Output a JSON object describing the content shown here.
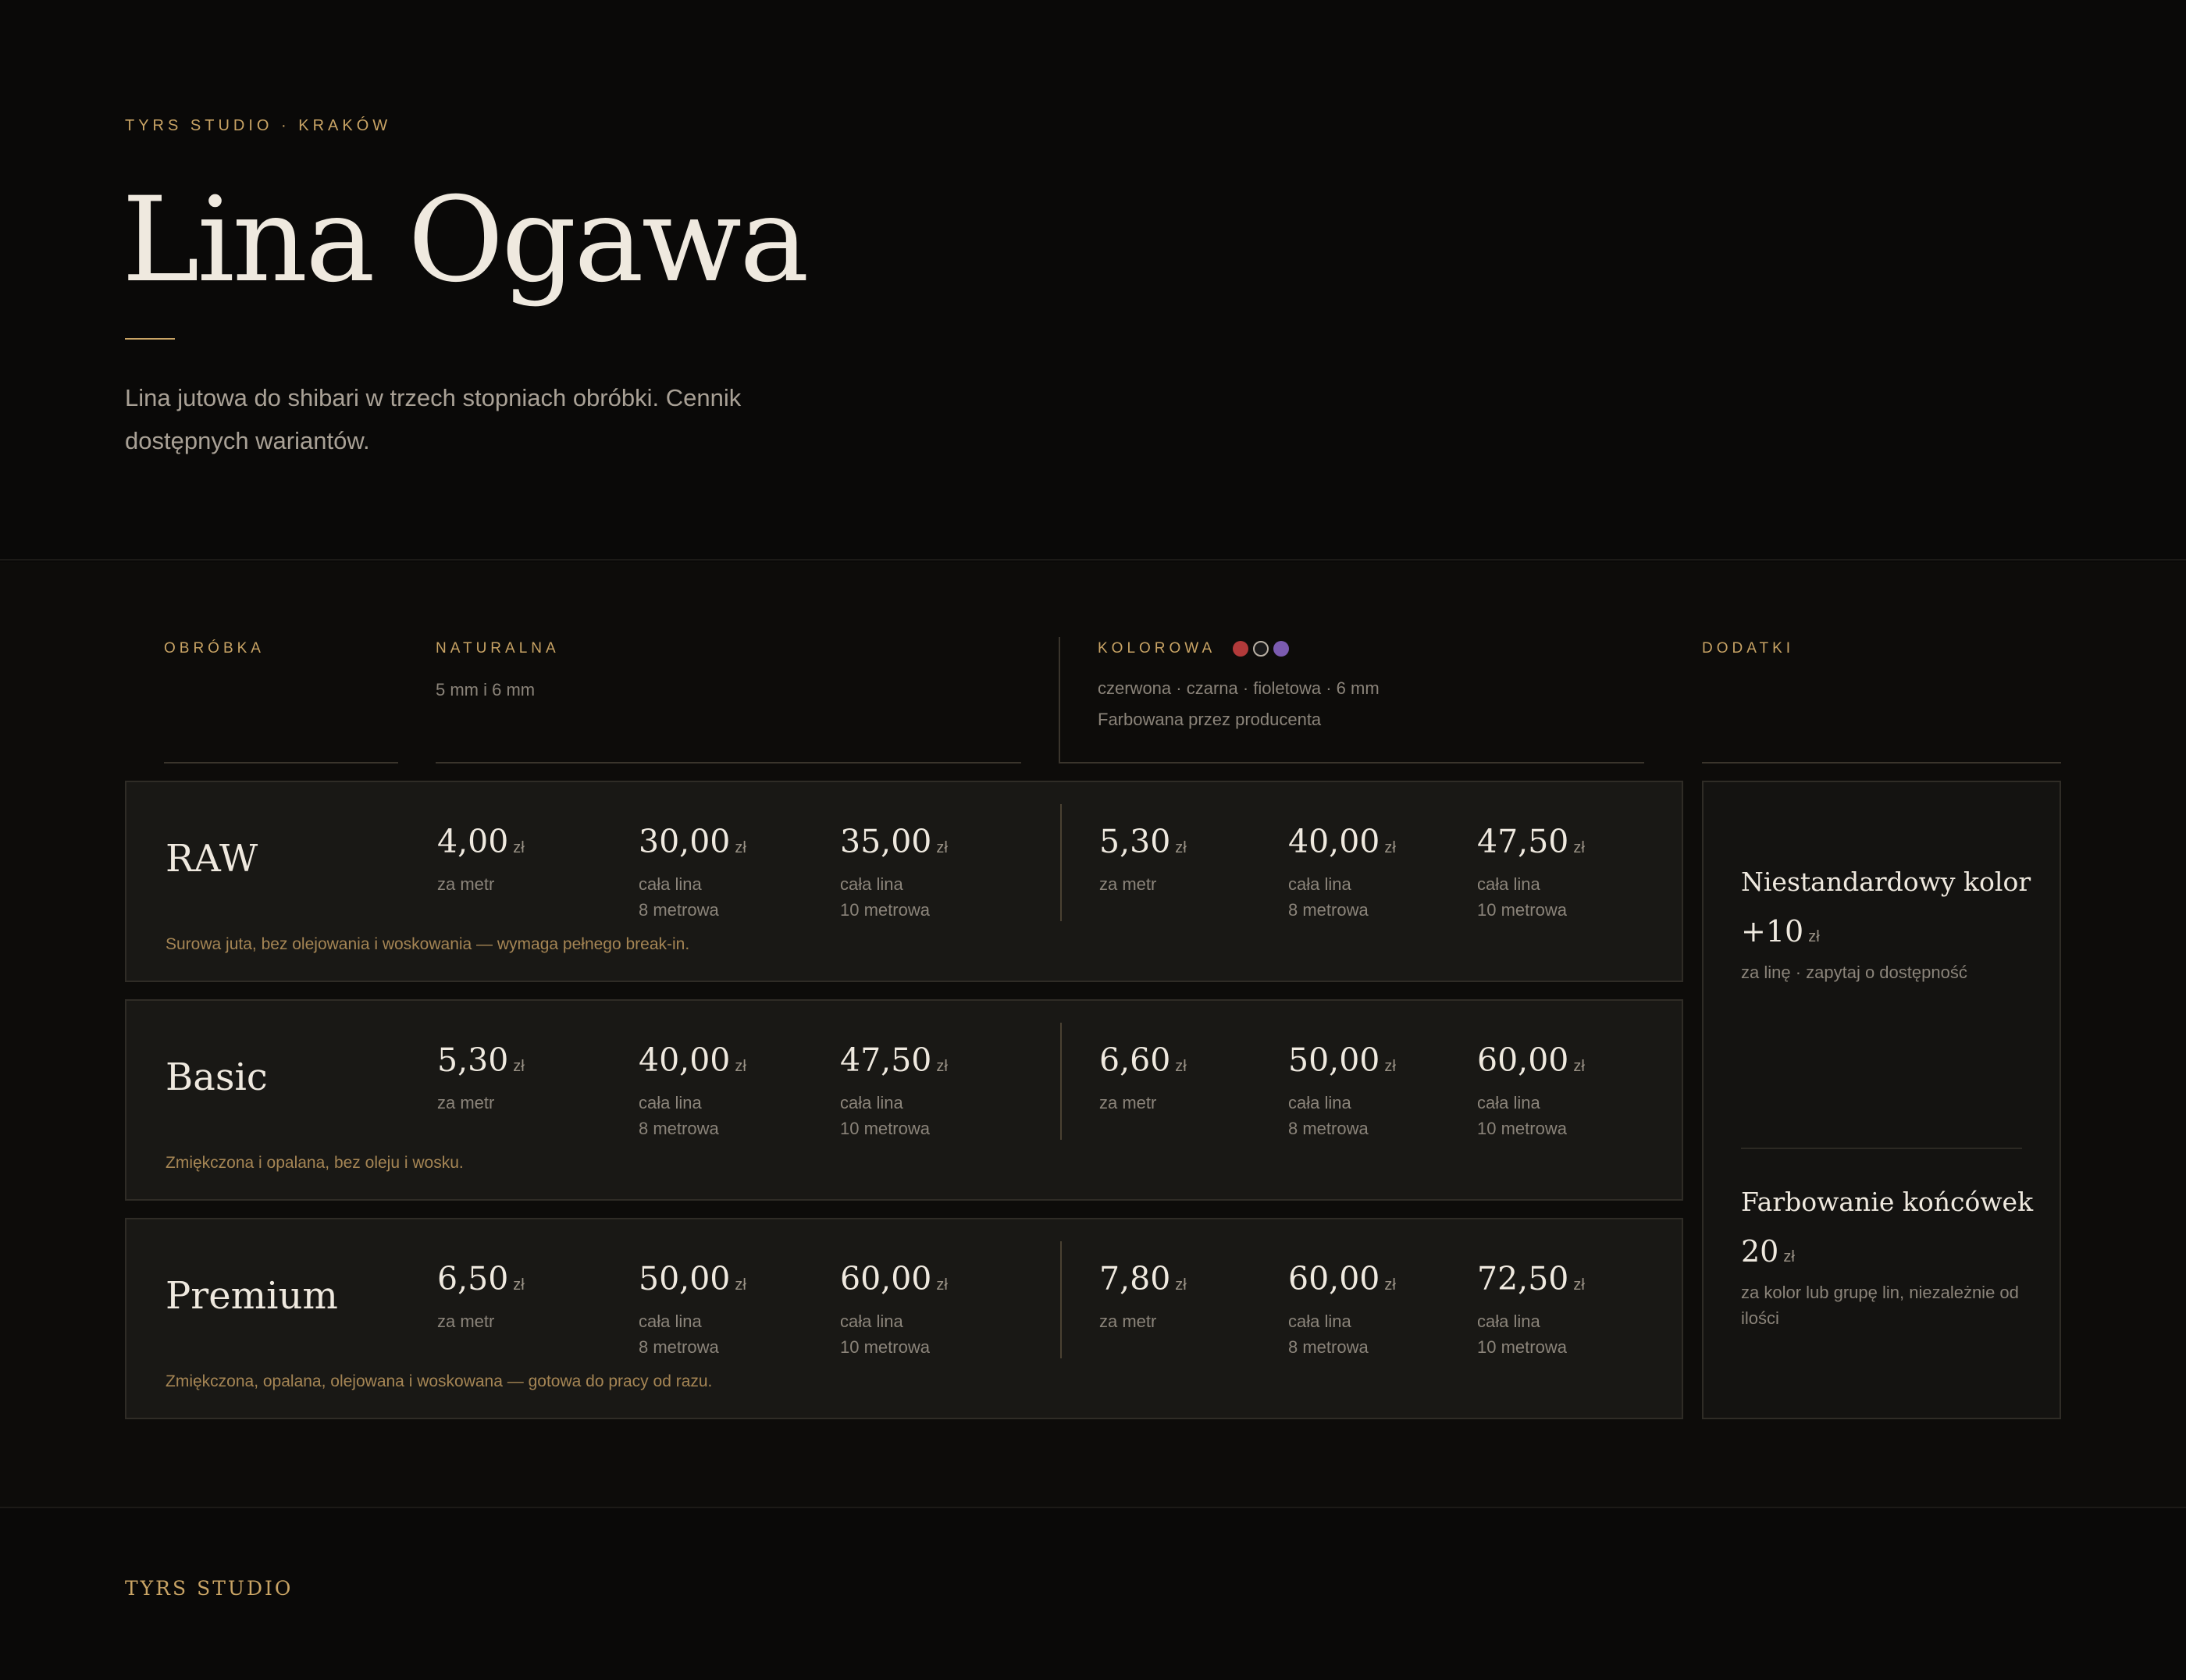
{
  "header": {
    "eyebrow": "TYRS STUDIO · KRAKÓW",
    "title": "Lina Ogawa",
    "description": "Lina jutowa do shibari w trzech stopniach obróbki. Cennik dostępnych wariantów."
  },
  "columns": {
    "treatment": {
      "label": "OBRÓBKA"
    },
    "natural": {
      "label": "NATURALNA",
      "sub": "5 mm i 6 mm"
    },
    "colored": {
      "label": "KOLOROWA",
      "sub": "czerwona · czarna · fioletowa · 6 mm",
      "sub2": "Farbowana przez producenta",
      "swatches": [
        "#b23a3a",
        "#1a1a1a",
        "#7b5bb0"
      ]
    },
    "extras": {
      "label": "DODATKI"
    }
  },
  "currency": "zł",
  "units": {
    "per_meter": "za metr",
    "whole": "cała lina",
    "len8": "8 metrowa",
    "len10": "10 metrowa"
  },
  "rows": [
    {
      "name": "RAW",
      "note": "Surowa juta, bez olejowania i woskowania — wymaga pełnego break-in.",
      "natural": [
        "4,00",
        "30,00",
        "35,00"
      ],
      "colored": [
        "5,30",
        "40,00",
        "47,50"
      ]
    },
    {
      "name": "Basic",
      "note": "Zmiękczona i opalana, bez oleju i wosku.",
      "natural": [
        "5,30",
        "40,00",
        "47,50"
      ],
      "colored": [
        "6,60",
        "50,00",
        "60,00"
      ]
    },
    {
      "name": "Premium",
      "note": "Zmiękczona, opalana, olejowana i woskowana — gotowa do pracy od razu.",
      "natural": [
        "6,50",
        "50,00",
        "60,00"
      ],
      "colored": [
        "7,80",
        "60,00",
        "72,50"
      ]
    }
  ],
  "extras": [
    {
      "title": "Niestandardowy kolor",
      "price": "+10",
      "note": "za linę · zapytaj o dostępność"
    },
    {
      "title": "Farbowanie końcówek",
      "price": "20",
      "note": "za kolor lub grupę lin, niezależnie od ilości"
    }
  ],
  "footer": {
    "brand": "TYRS STUDIO"
  }
}
